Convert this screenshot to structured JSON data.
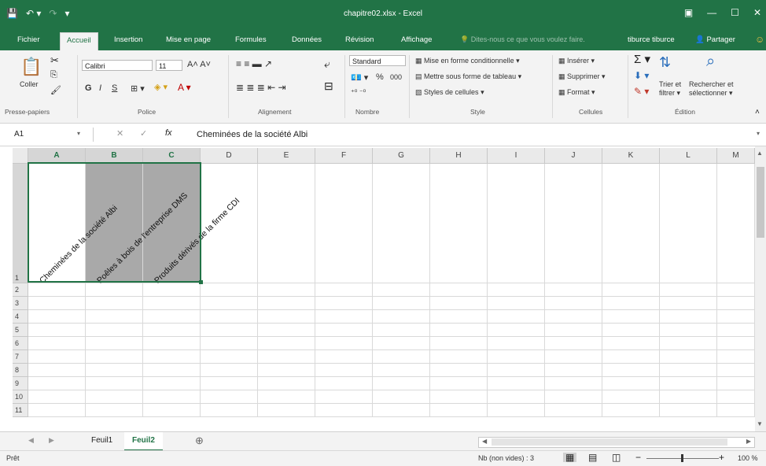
{
  "title_bar": {
    "doc_title": "chapitre02.xlsx - Excel",
    "accent": "#217346"
  },
  "tabs": {
    "file": "Fichier",
    "home": "Accueil",
    "insert": "Insertion",
    "layout": "Mise en page",
    "formulas": "Formules",
    "data": "Données",
    "review": "Révision",
    "view": "Affichage",
    "tell_me": "Dites-nous ce que vous voulez faire.",
    "user": "tiburce tiburce",
    "share": "Partager"
  },
  "ribbon": {
    "clipboard": {
      "paste": "Coller",
      "label": "Presse-papiers"
    },
    "font": {
      "name": "Calibri",
      "size": "11",
      "bold": "G",
      "italic": "I",
      "underline": "S",
      "label": "Police"
    },
    "alignment": {
      "label": "Alignement"
    },
    "number": {
      "format": "Standard",
      "percent": "%",
      "thousands": "000",
      "label": "Nombre"
    },
    "styles": {
      "conditional": "Mise en forme conditionnelle",
      "table": "Mettre sous forme de tableau",
      "cell_styles": "Styles de cellules",
      "label": "Style"
    },
    "cells": {
      "insert": "Insérer",
      "delete": "Supprimer",
      "format": "Format",
      "label": "Cellules"
    },
    "editing": {
      "sort_line1": "Trier et",
      "sort_line2": "filtrer",
      "find_line1": "Rechercher et",
      "find_line2": "sélectionner",
      "label": "Édition"
    }
  },
  "formula_bar": {
    "name_box": "A1",
    "formula": "Cheminées de la société Albi"
  },
  "grid": {
    "columns": [
      "A",
      "B",
      "C",
      "D",
      "E",
      "F",
      "G",
      "H",
      "I",
      "J",
      "K",
      "L",
      "M"
    ],
    "rows": [
      "1",
      "2",
      "3",
      "4",
      "5",
      "6",
      "7",
      "8",
      "9",
      "10",
      "11"
    ],
    "cells": {
      "A1": "Cheminées de la société Albi",
      "B1": "Poêles à bois de l'entreprise DMS",
      "C1": "Produits dérivés de la firme CDI"
    }
  },
  "sheets": {
    "tabs": [
      "Feuil1",
      "Feuil2"
    ],
    "active": "Feuil2"
  },
  "status": {
    "mode": "Prêt",
    "count": "Nb (non vides) : 3",
    "zoom": "100 %"
  }
}
